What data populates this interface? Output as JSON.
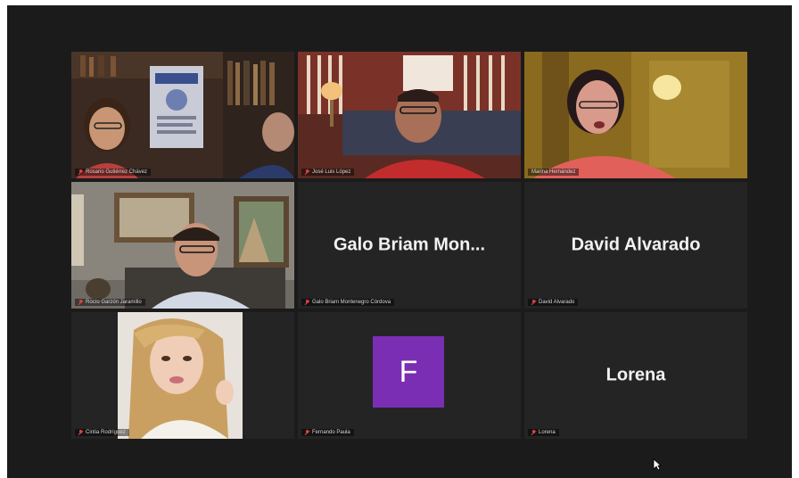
{
  "participants": [
    {
      "name": "Rosario Gutiérrez Chávez",
      "muted": true
    },
    {
      "name": "José Luis López",
      "muted": true
    },
    {
      "name": "Marina Hernández",
      "muted": false
    },
    {
      "name": "Rocío Garzón Jaramillo",
      "muted": true
    },
    {
      "name": "Galo Briam Montenegro Córdova",
      "display": "Galo  Briam  Mon...",
      "muted": true
    },
    {
      "name": "David Alvarado",
      "display": "David Alvarado",
      "muted": true
    },
    {
      "name": "Cintia Rodríguez",
      "muted": true
    },
    {
      "name": "Fernando Paula",
      "avatar_letter": "F",
      "avatar_color": "#7a2eb4",
      "muted": true
    },
    {
      "name": "Lorena",
      "display": "Lorena",
      "muted": true
    }
  ],
  "active_speaker_color": "#d9c94a",
  "mute_icon_color": "#e04040"
}
